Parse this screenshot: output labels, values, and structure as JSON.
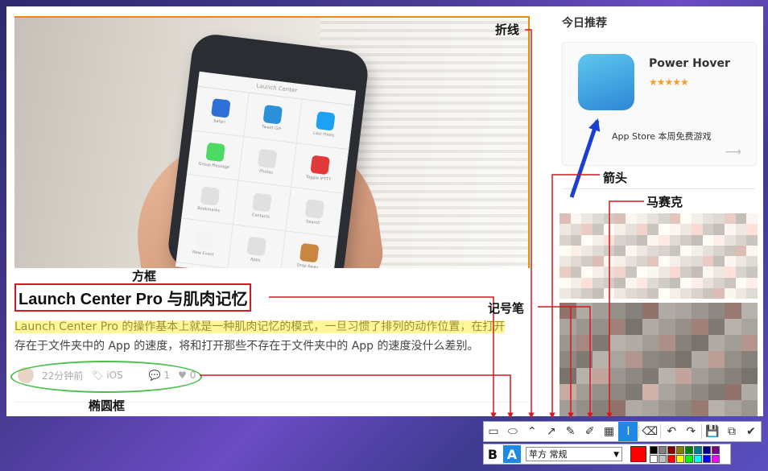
{
  "article": {
    "title": "Launch Center Pro 与肌肉记忆",
    "excerpt_highlighted": "Launch Center Pro 的操作基本上就是一种肌肉记忆的模式，一旦习惯了排列的动作位置，在打开",
    "excerpt_rest": "存在于文件夹中的 App 的速度，将和打开那些不存在于文件夹中的 App 的速度没什么差别。",
    "time": "22分钟前",
    "tag": "iOS",
    "comments": "1",
    "likes": "0"
  },
  "phone_screen": {
    "title": "Launch Center",
    "cells": [
      {
        "label": "Safari",
        "color": "#2d6fd6"
      },
      {
        "label": "Tweet GIF",
        "color": "#2a90d8"
      },
      {
        "label": "Last Photo",
        "color": "#1da1f2"
      },
      {
        "label": "Group Message",
        "color": "#4cd964"
      },
      {
        "label": "Photos",
        "color": "#e0e0e0"
      },
      {
        "label": "Toggle IFTTT",
        "color": "#e23a3a"
      },
      {
        "label": "Bookmarks",
        "color": "#e0e0e0"
      },
      {
        "label": "Contacts",
        "color": "#e0e0e0"
      },
      {
        "label": "Search",
        "color": "#e0e0e0"
      },
      {
        "label": "New Event",
        "color": "#f4f4f4"
      },
      {
        "label": "Apps",
        "color": "#e0e0e0"
      },
      {
        "label": "Drop Away",
        "color": "#c9863e"
      }
    ]
  },
  "sidebar": {
    "title": "今日推荐",
    "card": {
      "app_name": "Power Hover",
      "stars": "★★★★★",
      "rating": 4.5,
      "subtitle": "App Store 本周免费游戏",
      "arrow": "⟶"
    }
  },
  "annotations": {
    "polyline": "折线",
    "rectangle": "方框",
    "arrow": "箭头",
    "mosaic": "马赛克",
    "marker": "记号笔",
    "ellipse": "椭圆框"
  },
  "toolbar": {
    "tools": [
      {
        "name": "rectangle-tool",
        "glyph": "▭"
      },
      {
        "name": "ellipse-tool",
        "glyph": "⬭"
      },
      {
        "name": "polyline-tool",
        "glyph": "⌃"
      },
      {
        "name": "arrow-tool",
        "glyph": "↗"
      },
      {
        "name": "pen-tool",
        "glyph": "✎"
      },
      {
        "name": "marker-tool",
        "glyph": "✐"
      },
      {
        "name": "mosaic-tool",
        "glyph": "▦"
      },
      {
        "name": "text-tool",
        "glyph": "I",
        "active": true
      },
      {
        "name": "eraser-tool",
        "glyph": "⌫"
      },
      {
        "name": "undo-tool",
        "glyph": "↶"
      },
      {
        "name": "redo-tool",
        "glyph": "↷"
      },
      {
        "name": "save-tool",
        "glyph": "💾"
      },
      {
        "name": "copy-tool",
        "glyph": "⧉"
      },
      {
        "name": "confirm-tool",
        "glyph": "✔"
      }
    ]
  },
  "format": {
    "bold": "B",
    "fill": "A",
    "font": "苹方 常规",
    "current_color": "#ff0000",
    "palette": [
      "#000000",
      "#808080",
      "#800000",
      "#808000",
      "#008000",
      "#008080",
      "#000080",
      "#800080",
      "#ffffff",
      "#c0c0c0",
      "#ff0000",
      "#ffff00",
      "#00ff00",
      "#00ffff",
      "#0000ff",
      "#ff00ff"
    ]
  },
  "colors": {
    "annotation_red": "#d6171e",
    "annotation_blue": "#1a3fd6",
    "highlight": "#fff79a",
    "ellipse_green": "#4cc04c",
    "polyline_orange": "#f08a00"
  }
}
